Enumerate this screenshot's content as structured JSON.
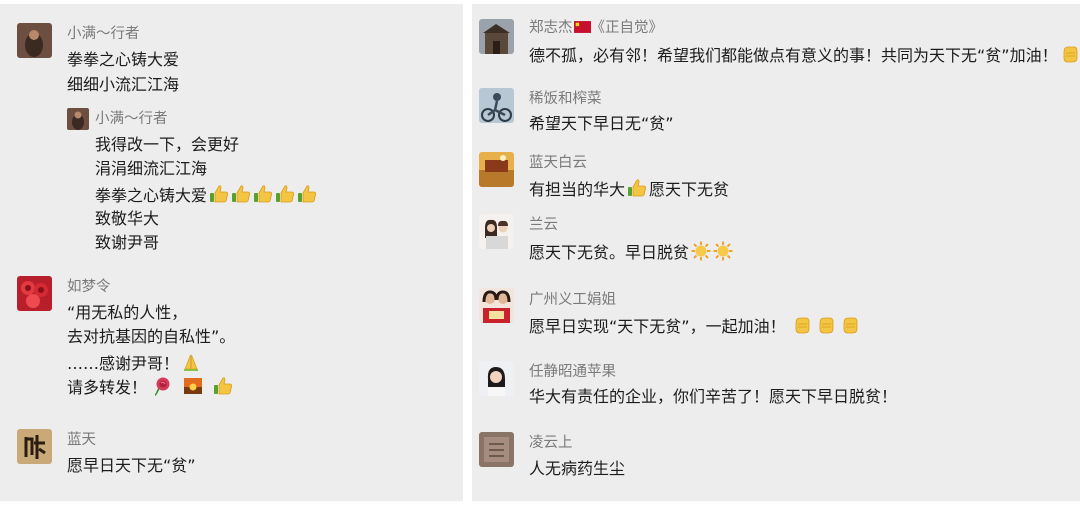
{
  "left": {
    "comments": [
      {
        "author": "小满～行者",
        "lines": [
          "拳拳之心铸大爱",
          "细细小流汇江海"
        ],
        "reply": {
          "author": "小满～行者",
          "lines": [
            "我得改一下，会更好",
            "涓涓细流汇江海",
            "拳拳之心铸大爱",
            "致敬华大",
            "致谢尹哥"
          ],
          "line_emojis": [
            "",
            "",
            "thumbs-up ×5",
            "",
            ""
          ]
        }
      },
      {
        "author": "如梦令",
        "lines": [
          "“用无私的人性，",
          "去对抗基因的自私性”。",
          "……感谢尹哥！",
          "请多转发！"
        ],
        "line_emojis": [
          "",
          "",
          "pray",
          "rose sunset thumbs-up"
        ]
      },
      {
        "author": "蓝天",
        "lines": [
          "愿早日天下无“贫”"
        ]
      }
    ]
  },
  "right": {
    "comments": [
      {
        "author": "郑志杰",
        "author_suffix": "《正自觉》",
        "lines": [
          "德不孤，必有邻！希望我们都能做点有意义的事！共同为天下无“贫”加油！"
        ],
        "emoji": "fist"
      },
      {
        "author": "稀饭和榨菜",
        "lines": [
          "希望天下早日无“贫”"
        ]
      },
      {
        "author": "蓝天白云",
        "lines_parts": [
          "有担当的华大",
          "愿天下无贫"
        ]
      },
      {
        "author": "兰云",
        "lines": [
          "愿天下无贫。早日脱贫"
        ],
        "emoji": "sun ×2"
      },
      {
        "author": "广州义工娟姐",
        "lines": [
          "愿早日实现“天下无贫”，一起加油！"
        ],
        "emoji": "fist ×3"
      },
      {
        "author": "任静昭通苹果",
        "lines": [
          "华大有责任的企业，你们辛苦了！愿天下早日脱贫！"
        ]
      },
      {
        "author": "凌云上",
        "lines": [
          "人无病药生尘"
        ]
      }
    ]
  },
  "colors": {
    "panel_bg": "#ededed",
    "name_text": "#7a7a7a",
    "body_text": "#1c1c1c",
    "flag_red": "#c8102e",
    "thumb_yellow": "#f4c542"
  },
  "icons": [
    "thumbs-up-icon",
    "pray-icon",
    "rose-icon",
    "sunset-icon",
    "fist-icon",
    "sun-icon",
    "flag-icon"
  ]
}
